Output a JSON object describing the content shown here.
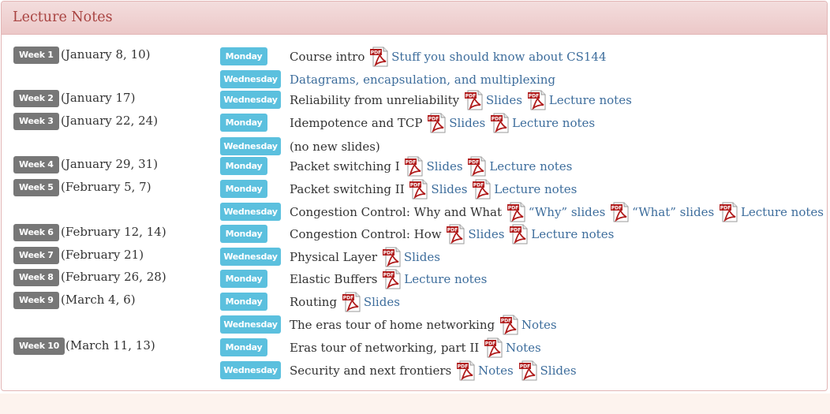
{
  "panel": {
    "title": "Lecture Notes"
  },
  "icons": {
    "pdf_label": "PDF",
    "pdf_color": "#b01c1c"
  },
  "rows": [
    {
      "week": "Week 1",
      "dates": "(January 8, 10)",
      "day": "Monday",
      "day_type": "mon",
      "items": [
        {
          "type": "text",
          "value": "Course intro"
        },
        {
          "type": "pdf"
        },
        {
          "type": "link",
          "value": "Stuff you should know about CS144"
        }
      ]
    },
    {
      "week": null,
      "dates": null,
      "day": "Wednesday",
      "day_type": "wed",
      "items": [
        {
          "type": "link",
          "value": "Datagrams, encapsulation, and multiplexing"
        }
      ]
    },
    {
      "week": "Week 2",
      "dates": "(January 17)",
      "day": "Wednesday",
      "day_type": "wed",
      "items": [
        {
          "type": "text",
          "value": "Reliability from unreliability"
        },
        {
          "type": "pdf"
        },
        {
          "type": "link",
          "value": "Slides"
        },
        {
          "type": "pdf"
        },
        {
          "type": "link",
          "value": "Lecture notes"
        }
      ]
    },
    {
      "week": "Week 3",
      "dates": "(January 22, 24)",
      "day": "Monday",
      "day_type": "mon",
      "items": [
        {
          "type": "text",
          "value": "Idempotence and TCP"
        },
        {
          "type": "pdf"
        },
        {
          "type": "link",
          "value": "Slides"
        },
        {
          "type": "pdf"
        },
        {
          "type": "link",
          "value": "Lecture notes"
        }
      ]
    },
    {
      "week": null,
      "dates": null,
      "day": "Wednesday",
      "day_type": "wed",
      "items": [
        {
          "type": "text",
          "value": "(no new slides)"
        }
      ]
    },
    {
      "week": "Week 4",
      "dates": "(January 29, 31)",
      "day": "Monday",
      "day_type": "mon",
      "items": [
        {
          "type": "text",
          "value": "Packet switching I"
        },
        {
          "type": "pdf"
        },
        {
          "type": "link",
          "value": "Slides"
        },
        {
          "type": "pdf"
        },
        {
          "type": "link",
          "value": "Lecture notes"
        }
      ]
    },
    {
      "week": "Week 5",
      "dates": "(February 5, 7)",
      "day": "Monday",
      "day_type": "mon",
      "items": [
        {
          "type": "text",
          "value": "Packet switching II"
        },
        {
          "type": "pdf"
        },
        {
          "type": "link",
          "value": "Slides"
        },
        {
          "type": "pdf"
        },
        {
          "type": "link",
          "value": "Lecture notes"
        }
      ]
    },
    {
      "week": null,
      "dates": null,
      "day": "Wednesday",
      "day_type": "wed",
      "items": [
        {
          "type": "text",
          "value": "Congestion Control: Why and What"
        },
        {
          "type": "pdf"
        },
        {
          "type": "link",
          "value": "“Why” slides"
        },
        {
          "type": "pdf"
        },
        {
          "type": "link",
          "value": "“What” slides"
        },
        {
          "type": "pdf"
        },
        {
          "type": "link",
          "value": "Lecture notes"
        }
      ]
    },
    {
      "week": "Week 6",
      "dates": "(February 12, 14)",
      "day": "Monday",
      "day_type": "mon",
      "items": [
        {
          "type": "text",
          "value": "Congestion Control: How"
        },
        {
          "type": "pdf"
        },
        {
          "type": "link",
          "value": "Slides"
        },
        {
          "type": "pdf"
        },
        {
          "type": "link",
          "value": "Lecture notes"
        }
      ]
    },
    {
      "week": "Week 7",
      "dates": "(February 21)",
      "day": "Wednesday",
      "day_type": "wed",
      "items": [
        {
          "type": "text",
          "value": "Physical Layer"
        },
        {
          "type": "pdf"
        },
        {
          "type": "link",
          "value": "Slides"
        }
      ]
    },
    {
      "week": "Week 8",
      "dates": "(February 26, 28)",
      "day": "Monday",
      "day_type": "mon",
      "items": [
        {
          "type": "text",
          "value": "Elastic Buffers"
        },
        {
          "type": "pdf"
        },
        {
          "type": "link",
          "value": "Lecture notes"
        }
      ]
    },
    {
      "week": "Week 9",
      "dates": "(March 4, 6)",
      "day": "Monday",
      "day_type": "mon",
      "items": [
        {
          "type": "text",
          "value": "Routing"
        },
        {
          "type": "pdf"
        },
        {
          "type": "link",
          "value": "Slides"
        }
      ]
    },
    {
      "week": null,
      "dates": null,
      "day": "Wednesday",
      "day_type": "wed",
      "items": [
        {
          "type": "text",
          "value": "The eras tour of home networking"
        },
        {
          "type": "pdf"
        },
        {
          "type": "link",
          "value": "Notes"
        }
      ]
    },
    {
      "week": "Week 10",
      "dates": "(March 11, 13)",
      "day": "Monday",
      "day_type": "mon",
      "items": [
        {
          "type": "text",
          "value": "Eras tour of networking, part II"
        },
        {
          "type": "pdf"
        },
        {
          "type": "link",
          "value": "Notes"
        }
      ]
    },
    {
      "week": null,
      "dates": null,
      "day": "Wednesday",
      "day_type": "wed",
      "items": [
        {
          "type": "text",
          "value": "Security and next frontiers"
        },
        {
          "type": "pdf"
        },
        {
          "type": "link",
          "value": "Notes"
        },
        {
          "type": "pdf"
        },
        {
          "type": "link",
          "value": "Slides"
        }
      ]
    }
  ]
}
